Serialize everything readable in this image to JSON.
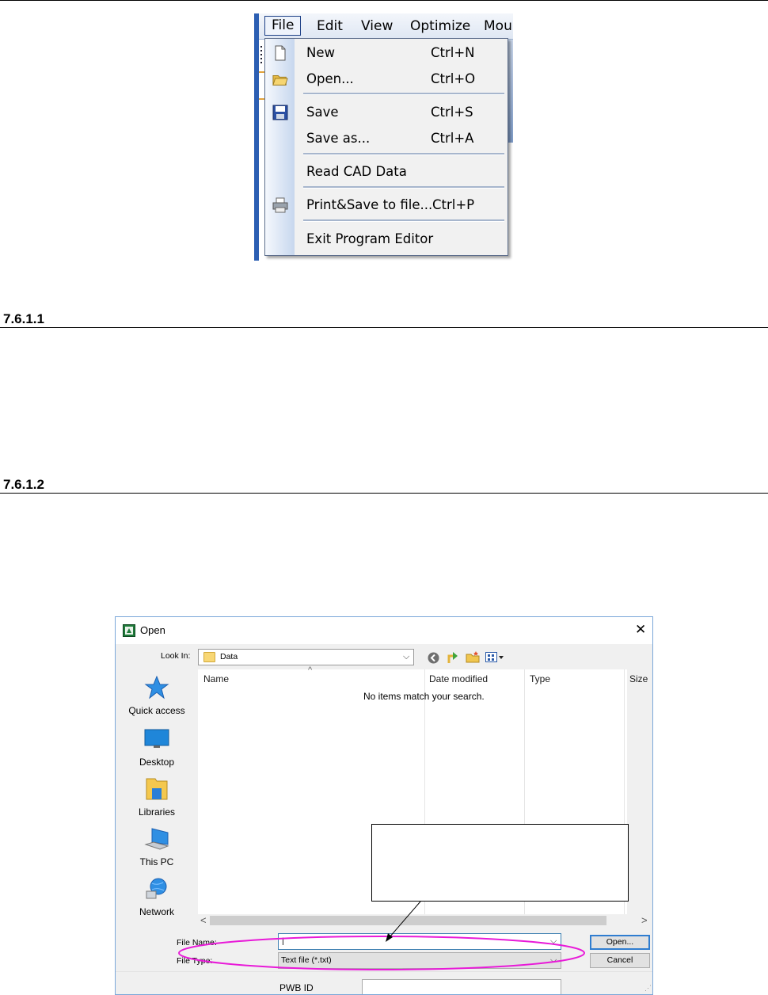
{
  "menu_screenshot": {
    "menubar": [
      "File",
      "Edit",
      "View",
      "Optimize",
      "Mour"
    ],
    "items": [
      {
        "label": "New",
        "shortcut": "Ctrl+N",
        "icon": "new-document-icon"
      },
      {
        "label": "Open...",
        "shortcut": "Ctrl+O",
        "icon": "open-folder-icon"
      },
      {
        "label": "Save",
        "shortcut": "Ctrl+S",
        "icon": "floppy-disk-icon"
      },
      {
        "label": "Save as...",
        "shortcut": "Ctrl+A",
        "icon": ""
      },
      {
        "label": "Read CAD Data",
        "shortcut": "",
        "icon": ""
      },
      {
        "label": "Print&Save to file...",
        "shortcut": "Ctrl+P",
        "icon": "printer-icon"
      },
      {
        "label": "Exit Program Editor",
        "shortcut": "",
        "icon": ""
      }
    ]
  },
  "sections": [
    {
      "number": "7.6.1.1"
    },
    {
      "number": "7.6.1.2"
    }
  ],
  "dialog": {
    "title": "Open",
    "close_glyph": "✕",
    "look_in_label": "Look In:",
    "look_in_value": "Data",
    "places": [
      "Quick access",
      "Desktop",
      "Libraries",
      "This PC",
      "Network"
    ],
    "columns": [
      "Name",
      "Date modified",
      "Type",
      "Size"
    ],
    "empty_message": "No items match your search.",
    "file_name_label": "File Name:",
    "file_name_value": "|",
    "file_type_label": "File Type:",
    "file_type_value": "Text file (*.txt)",
    "open_button": "Open...",
    "cancel_button": "Cancel",
    "pwb_label": "PWB ID"
  },
  "colors": {
    "highlight_ellipse": "#e81ad8",
    "dialog_border": "#7aa7d9",
    "default_button_border": "#2f7dd0"
  }
}
